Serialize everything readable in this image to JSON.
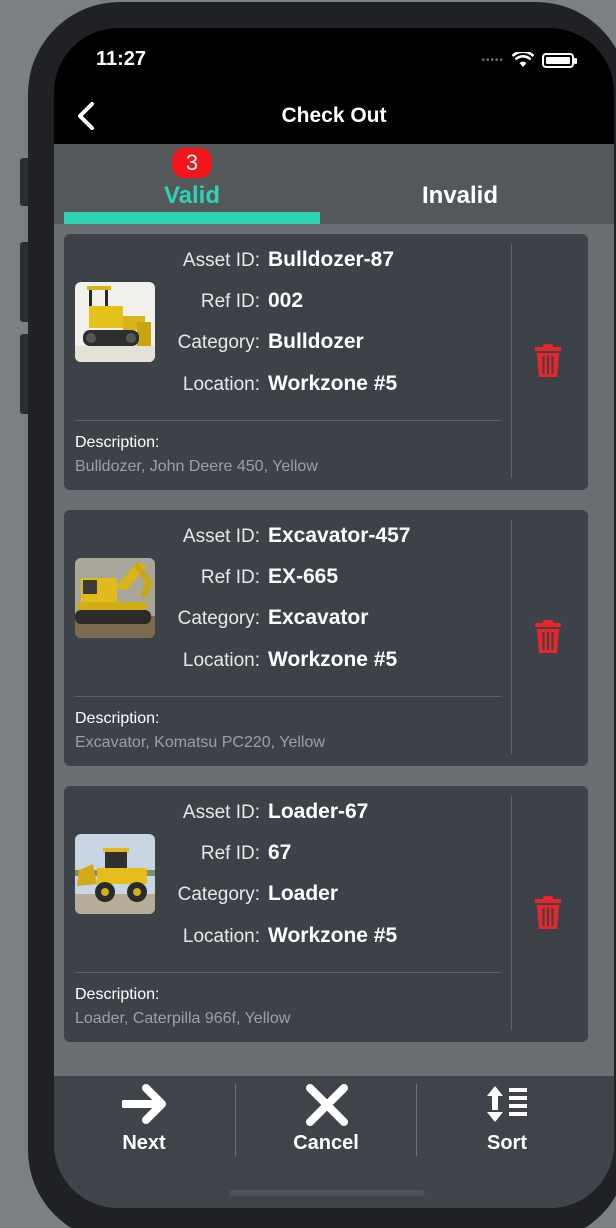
{
  "status_bar": {
    "time": "11:27",
    "signal": "•••••"
  },
  "nav": {
    "title": "Check Out"
  },
  "tabs": [
    {
      "label": "Valid",
      "badge": "3",
      "selected": true
    },
    {
      "label": "Invalid",
      "selected": false
    }
  ],
  "field_labels": {
    "asset_id": "Asset ID:",
    "ref_id": "Ref ID:",
    "category": "Category:",
    "location": "Location:",
    "description": "Description:"
  },
  "assets": [
    {
      "asset_id": "Bulldozer-87",
      "ref_id": "002",
      "category": "Bulldozer",
      "location": "Workzone #5",
      "description": "Bulldozer, John Deere 450, Yellow",
      "image": "bulldozer-photo"
    },
    {
      "asset_id": "Excavator-457",
      "ref_id": "EX-665",
      "category": "Excavator",
      "location": "Workzone #5",
      "description": "Excavator, Komatsu PC220, Yellow",
      "image": "excavator-photo"
    },
    {
      "asset_id": "Loader-67",
      "ref_id": "67",
      "category": "Loader",
      "location": "Workzone #5",
      "description": "Loader, Caterpilla 966f, Yellow",
      "image": "loader-photo"
    }
  ],
  "toolbar": {
    "next_label": "Next",
    "cancel_label": "Cancel",
    "sort_label": "Sort"
  },
  "colors": {
    "accent": "#2dd4b4",
    "badge": "#f0161c",
    "delete": "#e8262a",
    "card_bg": "#3d4249"
  }
}
